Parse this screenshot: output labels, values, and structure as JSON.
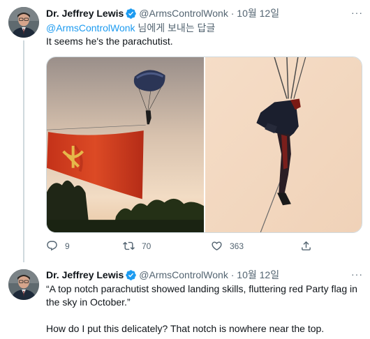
{
  "tweets": [
    {
      "author": {
        "name": "Dr. Jeffrey Lewis",
        "handle": "@ArmsControlWonk",
        "date": "10월 12일",
        "separator": "·"
      },
      "reply_to": {
        "mention": "@ArmsControlWonk",
        "suffix": " 님에게 보내는 답글"
      },
      "text": "It seems he's the parachutist.",
      "stats": {
        "replies": "9",
        "retweets": "70",
        "likes": "363"
      }
    },
    {
      "author": {
        "name": "Dr. Jeffrey Lewis",
        "handle": "@ArmsControlWonk",
        "date": "10월 12일",
        "separator": "·"
      },
      "quote": "“A top notch parachutist showed landing skills, fluttering red Party flag in the sky in October.”",
      "text": "How do I put this delicately? That notch is nowhere near the top."
    }
  ],
  "icons": {
    "verified": "verified-badge-icon",
    "more": "more-icon",
    "reply": "reply-icon",
    "retweet": "retweet-icon",
    "like": "heart-icon",
    "share": "share-icon"
  },
  "colors": {
    "accent": "#1d9bf0",
    "secondary_text": "#536471",
    "flag_red": "#d63a1f",
    "divider": "#cfd9de"
  }
}
